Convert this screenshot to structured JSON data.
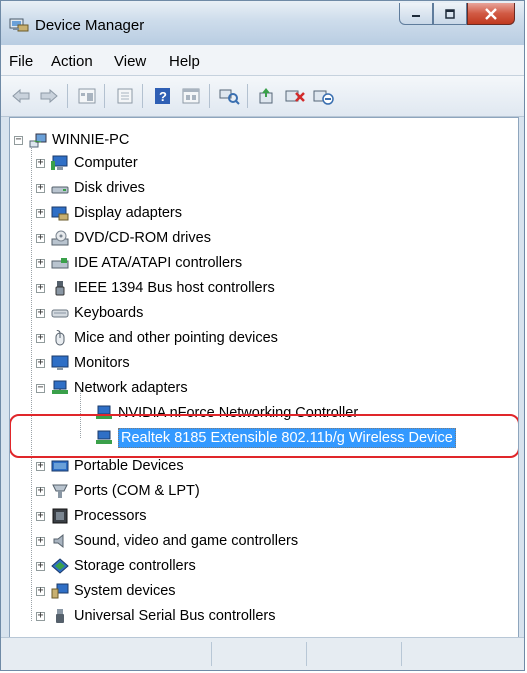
{
  "window": {
    "title": "Device Manager",
    "icon": "device-manager-icon",
    "buttons": [
      "minimize-icon",
      "maximize-icon",
      "close-icon"
    ]
  },
  "menu": [
    {
      "label": "File"
    },
    {
      "label": "Action"
    },
    {
      "label": "View"
    },
    {
      "label": "Help"
    }
  ],
  "toolbar": [
    "back-icon",
    "forward-icon",
    "properties-icon",
    "show-hide-icon",
    "help-icon",
    "console-icon",
    "scan-hardware-icon",
    "update-driver-icon",
    "uninstall-icon",
    "disable-icon"
  ],
  "tree": {
    "root": {
      "label": "WINNIE-PC",
      "icon": "computer-network-icon",
      "expanded": true
    },
    "categories": [
      {
        "label": "Computer",
        "icon": "computer-icon",
        "expanded": false
      },
      {
        "label": "Disk drives",
        "icon": "disk-drive-icon",
        "expanded": false
      },
      {
        "label": "Display adapters",
        "icon": "display-adapter-icon",
        "expanded": false
      },
      {
        "label": "DVD/CD-ROM drives",
        "icon": "dvd-drive-icon",
        "expanded": false
      },
      {
        "label": "IDE ATA/ATAPI controllers",
        "icon": "ide-controller-icon",
        "expanded": false
      },
      {
        "label": "IEEE 1394 Bus host controllers",
        "icon": "firewire-icon",
        "expanded": false
      },
      {
        "label": "Keyboards",
        "icon": "keyboard-icon",
        "expanded": false
      },
      {
        "label": "Mice and other pointing devices",
        "icon": "mouse-icon",
        "expanded": false
      },
      {
        "label": "Monitors",
        "icon": "monitor-icon",
        "expanded": false
      },
      {
        "label": "Network adapters",
        "icon": "network-adapter-icon",
        "expanded": true,
        "children": [
          {
            "label": "NVIDIA nForce Networking Controller",
            "icon": "network-adapter-icon",
            "selected": false
          },
          {
            "label": "Realtek 8185 Extensible 802.11b/g Wireless Device",
            "icon": "network-adapter-icon",
            "selected": true
          }
        ]
      },
      {
        "label": "Portable Devices",
        "icon": "portable-device-icon",
        "expanded": false
      },
      {
        "label": "Ports (COM & LPT)",
        "icon": "port-icon",
        "expanded": false
      },
      {
        "label": "Processors",
        "icon": "processor-icon",
        "expanded": false
      },
      {
        "label": "Sound, video and game controllers",
        "icon": "speaker-icon",
        "expanded": false
      },
      {
        "label": "Storage controllers",
        "icon": "storage-controller-icon",
        "expanded": false
      },
      {
        "label": "System devices",
        "icon": "system-device-icon",
        "expanded": false
      },
      {
        "label": "Universal Serial Bus controllers",
        "icon": "usb-icon",
        "expanded": false
      }
    ]
  },
  "colors": {
    "selection": "#3399ff",
    "highlight_ring": "#e0262a",
    "window_frame": "#b9cde2"
  }
}
